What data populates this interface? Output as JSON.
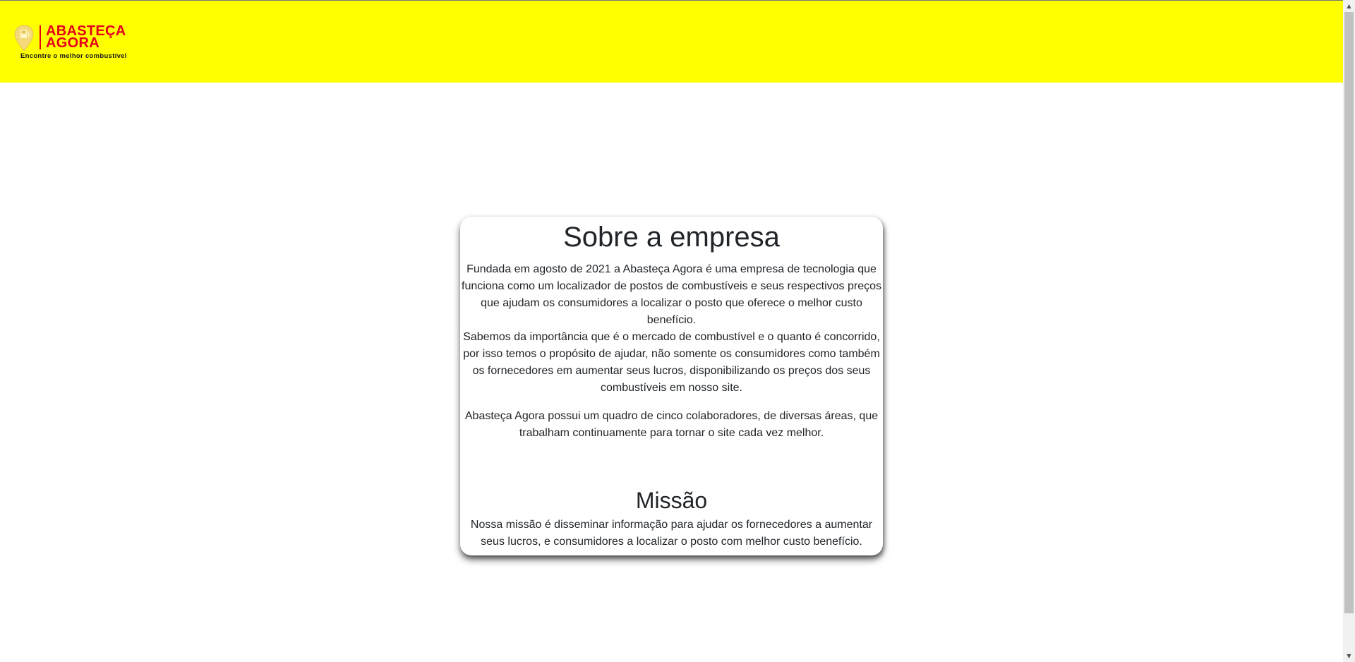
{
  "header": {
    "logo": {
      "line1": "ABASTEÇA",
      "line2": "AGORA",
      "tagline": "Encontre o melhor combustível"
    },
    "background_color": "#ffff00",
    "brand_color": "#e3001b"
  },
  "about": {
    "title": "Sobre a empresa",
    "paragraph1_a": "Fundada em agosto de 2021 a Abasteça Agora é uma empresa de tecnologia que funciona como um localizador de postos de combustíveis e seus respectivos preços que ajudam os consumidores a localizar o posto que oferece o melhor custo benefício.",
    "paragraph1_b": "Sabemos da importância que é o mercado de combustível e o quanto é concorrido, por isso temos o propósito de ajudar, não somente os consumidores como também os fornecedores em aumentar seus lucros, disponibilizando os preços dos seus combustíveis em nosso site.",
    "paragraph2": "Abasteça Agora possui um quadro de cinco colaboradores, de diversas áreas, que trabalham continuamente para tornar o site cada vez melhor."
  },
  "mission": {
    "title": "Missão",
    "text": "Nossa missão é disseminar informação para ajudar os fornecedores a aumentar seus lucros, e consumidores a localizar o posto com melhor custo benefício."
  },
  "scrollbar": {
    "up_arrow": "▲",
    "down_arrow": "▼"
  }
}
